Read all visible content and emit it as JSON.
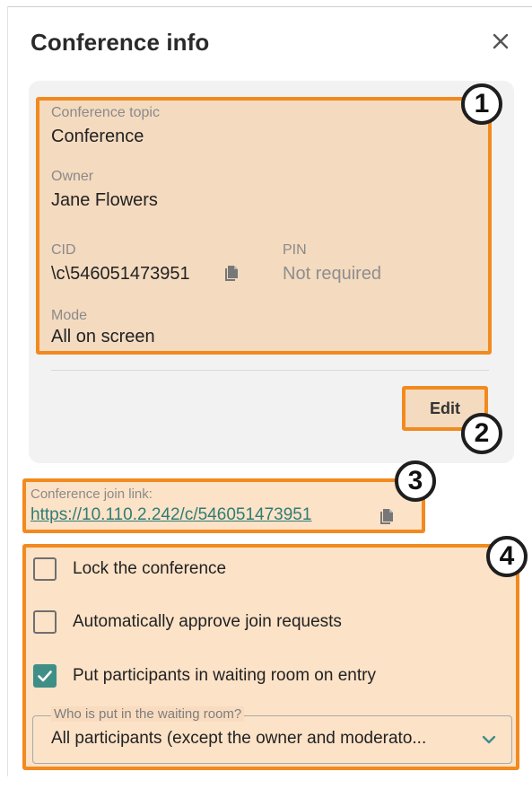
{
  "dialog": {
    "title": "Conference info"
  },
  "info": {
    "topic_label": "Conference topic",
    "topic_value": "Conference",
    "owner_label": "Owner",
    "owner_value": "Jane Flowers",
    "cid_label": "CID",
    "cid_value": "\\c\\546051473951",
    "pin_label": "PIN",
    "pin_value": "Not required",
    "mode_label": "Mode",
    "mode_value": "All on screen"
  },
  "actions": {
    "edit_label": "Edit"
  },
  "join": {
    "label": "Conference join link:",
    "url": "https://10.110.2.242/c/546051473951"
  },
  "options": {
    "lock_label": "Lock the conference",
    "lock_checked": false,
    "auto_approve_label": "Automatically approve join requests",
    "auto_approve_checked": false,
    "waiting_room_label": "Put participants in waiting room on entry",
    "waiting_room_checked": true,
    "waiting_select_legend": "Who is put in the waiting room?",
    "waiting_select_value": "All participants (except the owner and moderato..."
  },
  "annotations": {
    "n1": "1",
    "n2": "2",
    "n3": "3",
    "n4": "4"
  },
  "colors": {
    "accent": "#3f8f87",
    "link": "#2e7d74",
    "highlight_border": "#f28a1f",
    "card_bg": "#f2f2f2"
  },
  "icons": {
    "close": "close-icon",
    "copy": "copy-icon",
    "check": "check-icon",
    "chevron": "chevron-down-icon"
  }
}
